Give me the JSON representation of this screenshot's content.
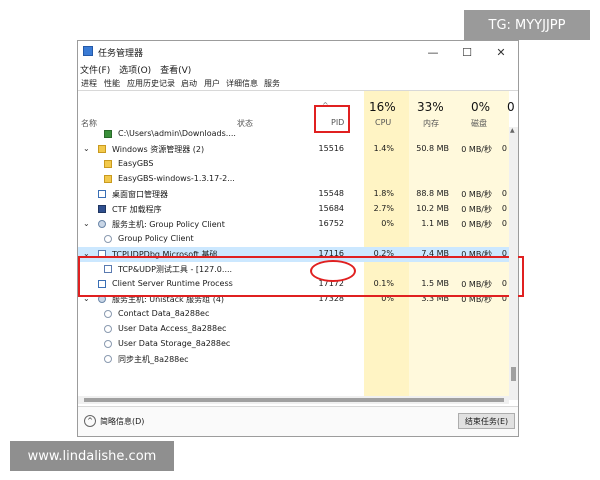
{
  "watermark": {
    "top": "TG: MYYJJPP",
    "bottom": "www.lindalishe.com"
  },
  "window": {
    "title": "任务管理器",
    "minimize": "—",
    "maximize": "☐",
    "close": "✕"
  },
  "menu": [
    "文件(F)",
    "选项(O)",
    "查看(V)"
  ],
  "tabs": [
    "进程",
    "性能",
    "应用历史记录",
    "启动",
    "用户",
    "详细信息",
    "服务"
  ],
  "columns": {
    "name": "名称",
    "status": "状态",
    "pid": "PID",
    "cpu": "CPU",
    "cpu_pct": "16%",
    "mem": "内存",
    "mem_pct": "33%",
    "disk": "磁盘",
    "disk_pct": "0%",
    "net_pct": "0"
  },
  "rows": [
    {
      "expand": "",
      "icon": "file-icon",
      "name": "C:\\Users\\admin\\Downloads....",
      "pid": "",
      "cpu": "",
      "mem": "",
      "disk": "",
      "net": ""
    },
    {
      "expand": "⌄",
      "icon": "folder-icon",
      "name": "Windows 资源管理器 (2)",
      "pid": "15516",
      "cpu": "1.4%",
      "mem": "50.8 MB",
      "disk": "0 MB/秒",
      "net": "0"
    },
    {
      "expand": "",
      "icon": "folder-icon",
      "name": "EasyGBS",
      "pid": "",
      "cpu": "",
      "mem": "",
      "disk": "",
      "net": ""
    },
    {
      "expand": "",
      "icon": "folder-icon",
      "name": "EasyGBS-windows-1.3.17-2...",
      "pid": "",
      "cpu": "",
      "mem": "",
      "disk": "",
      "net": ""
    },
    {
      "expand": "",
      "icon": "window-icon",
      "name": "桌面窗口管理器",
      "pid": "15548",
      "cpu": "1.8%",
      "mem": "88.8 MB",
      "disk": "0 MB/秒",
      "net": "0"
    },
    {
      "expand": "",
      "icon": "pen-icon",
      "name": "CTF 加载程序",
      "pid": "15684",
      "cpu": "2.7%",
      "mem": "10.2 MB",
      "disk": "0 MB/秒",
      "net": "0"
    },
    {
      "expand": "⌄",
      "icon": "gear-icon",
      "name": "服务主机: Group Policy Client",
      "pid": "16752",
      "cpu": "0%",
      "mem": "1.1 MB",
      "disk": "0 MB/秒",
      "net": "0"
    },
    {
      "expand": "",
      "icon": "service-icon",
      "name": "Group Policy Client",
      "pid": "",
      "cpu": "",
      "mem": "",
      "disk": "",
      "net": ""
    },
    {
      "expand": "⌄",
      "icon": "app-icon",
      "name": "TCPUDPDbg Microsoft 基础...",
      "pid": "17116",
      "cpu": "0.2%",
      "mem": "7.4 MB",
      "disk": "0 MB/秒",
      "net": "0",
      "selected": true
    },
    {
      "expand": "",
      "icon": "app-icon",
      "name": "TCP&UDP测试工具 - [127.0....",
      "pid": "",
      "cpu": "",
      "mem": "",
      "disk": "",
      "net": ""
    },
    {
      "expand": "",
      "icon": "window-icon",
      "name": "Client Server Runtime Process",
      "pid": "17172",
      "cpu": "0.1%",
      "mem": "1.5 MB",
      "disk": "0 MB/秒",
      "net": "0"
    },
    {
      "expand": "⌄",
      "icon": "gear-icon",
      "name": "服务主机: Unistack 服务组 (4)",
      "pid": "17328",
      "cpu": "0%",
      "mem": "3.3 MB",
      "disk": "0 MB/秒",
      "net": "0"
    },
    {
      "expand": "",
      "icon": "service-icon",
      "name": "Contact Data_8a288ec",
      "pid": "",
      "cpu": "",
      "mem": "",
      "disk": "",
      "net": ""
    },
    {
      "expand": "",
      "icon": "service-icon",
      "name": "User Data Access_8a288ec",
      "pid": "",
      "cpu": "",
      "mem": "",
      "disk": "",
      "net": ""
    },
    {
      "expand": "",
      "icon": "service-icon",
      "name": "User Data Storage_8a288ec",
      "pid": "",
      "cpu": "",
      "mem": "",
      "disk": "",
      "net": ""
    },
    {
      "expand": "",
      "icon": "service-icon",
      "name": "同步主机_8a288ec",
      "pid": "",
      "cpu": "",
      "mem": "",
      "disk": "",
      "net": ""
    }
  ],
  "footer": {
    "fewer_details": "简略信息(D)",
    "end_task": "结束任务(E)"
  },
  "colors": {
    "selected_row": "#cce8ff",
    "annotation": "#e02020",
    "cpu_col": "#fff4c4",
    "mem_col": "#fff9dc"
  }
}
